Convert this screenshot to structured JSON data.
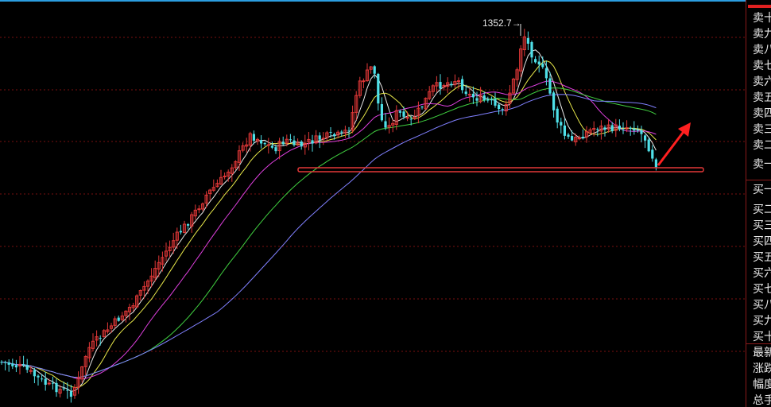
{
  "chart_data": {
    "type": "candlestick",
    "peak_annotation": "1352.7→",
    "peak_value": 1352.7,
    "colors": {
      "up": "#e23838",
      "down": "#4fe0e8",
      "grid": "#7a0f0f",
      "ma_white": "#e8e8e8",
      "ma_yellow": "#e8e84a",
      "ma_magenta": "#e040e0",
      "ma_green": "#40d040",
      "ma_blue": "#8080ff",
      "support_line": "#e23838",
      "arrow": "#ff2020"
    },
    "moving_averages": [
      "white",
      "yellow",
      "magenta",
      "green",
      "blue"
    ],
    "grid": true,
    "overlay": [
      "horizontal-support-box",
      "up-arrow"
    ]
  },
  "order_book": {
    "sell": [
      "卖十",
      "卖九",
      "卖八",
      "卖七",
      "卖六",
      "卖五",
      "卖四",
      "卖三",
      "卖二",
      "卖一"
    ],
    "buy": [
      "买一",
      "买二",
      "买三",
      "买四",
      "买五",
      "买六",
      "买七",
      "买八",
      "买九",
      "买十"
    ],
    "summary": [
      "最新",
      "涨跌",
      "幅度",
      "总手"
    ]
  }
}
